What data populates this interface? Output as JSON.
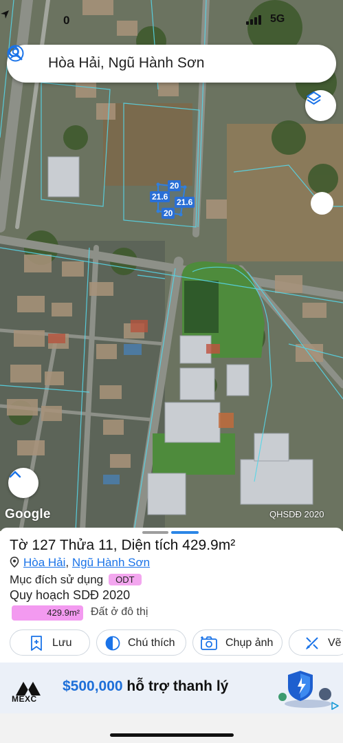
{
  "status_bar": {
    "time": "0",
    "location_arrow": "location-arrow-icon",
    "network": "5G"
  },
  "search": {
    "query": "Hòa Hải, Ngũ Hành Sơn",
    "left_icon": "user-icon",
    "right_icon": "search-icon"
  },
  "map": {
    "dimension_labels": [
      "20",
      "21.6",
      "21.6",
      "20"
    ],
    "attribution": "Google",
    "layer_label": "QHSDĐ 2020",
    "colors": {
      "parcel_outline": "#2f7fe0",
      "plan_line": "#56d6e8",
      "grass": "#4e8b3c"
    }
  },
  "sheet": {
    "title": "Tờ 127 Thửa 11, Diện tích 429.9m²",
    "ward": "Hòa Hải",
    "separator": ", ",
    "district": "Ngũ Hành Sơn",
    "land_use_label": "Mục đích sử dụng",
    "land_use_code": "ODT",
    "plan_label": "Quy hoạch SDĐ 2020",
    "area_value": "429.9m²",
    "area_fraction": 1.0,
    "area_description": "Đất ở đô thị",
    "colors": {
      "badge": "#f3a6ef",
      "link": "#1a73e8"
    },
    "actions": [
      {
        "label": "Lưu",
        "icon": "bookmark-add-icon"
      },
      {
        "label": "Chú thích",
        "icon": "half-circle-icon"
      },
      {
        "label": "Chụp ảnh",
        "icon": "camera-icon"
      },
      {
        "label": "Vẽ",
        "icon": "draw-icon"
      }
    ]
  },
  "ad": {
    "brand": "MEXC",
    "amount": "$500,000",
    "text": " hỗ trợ thanh lý"
  }
}
